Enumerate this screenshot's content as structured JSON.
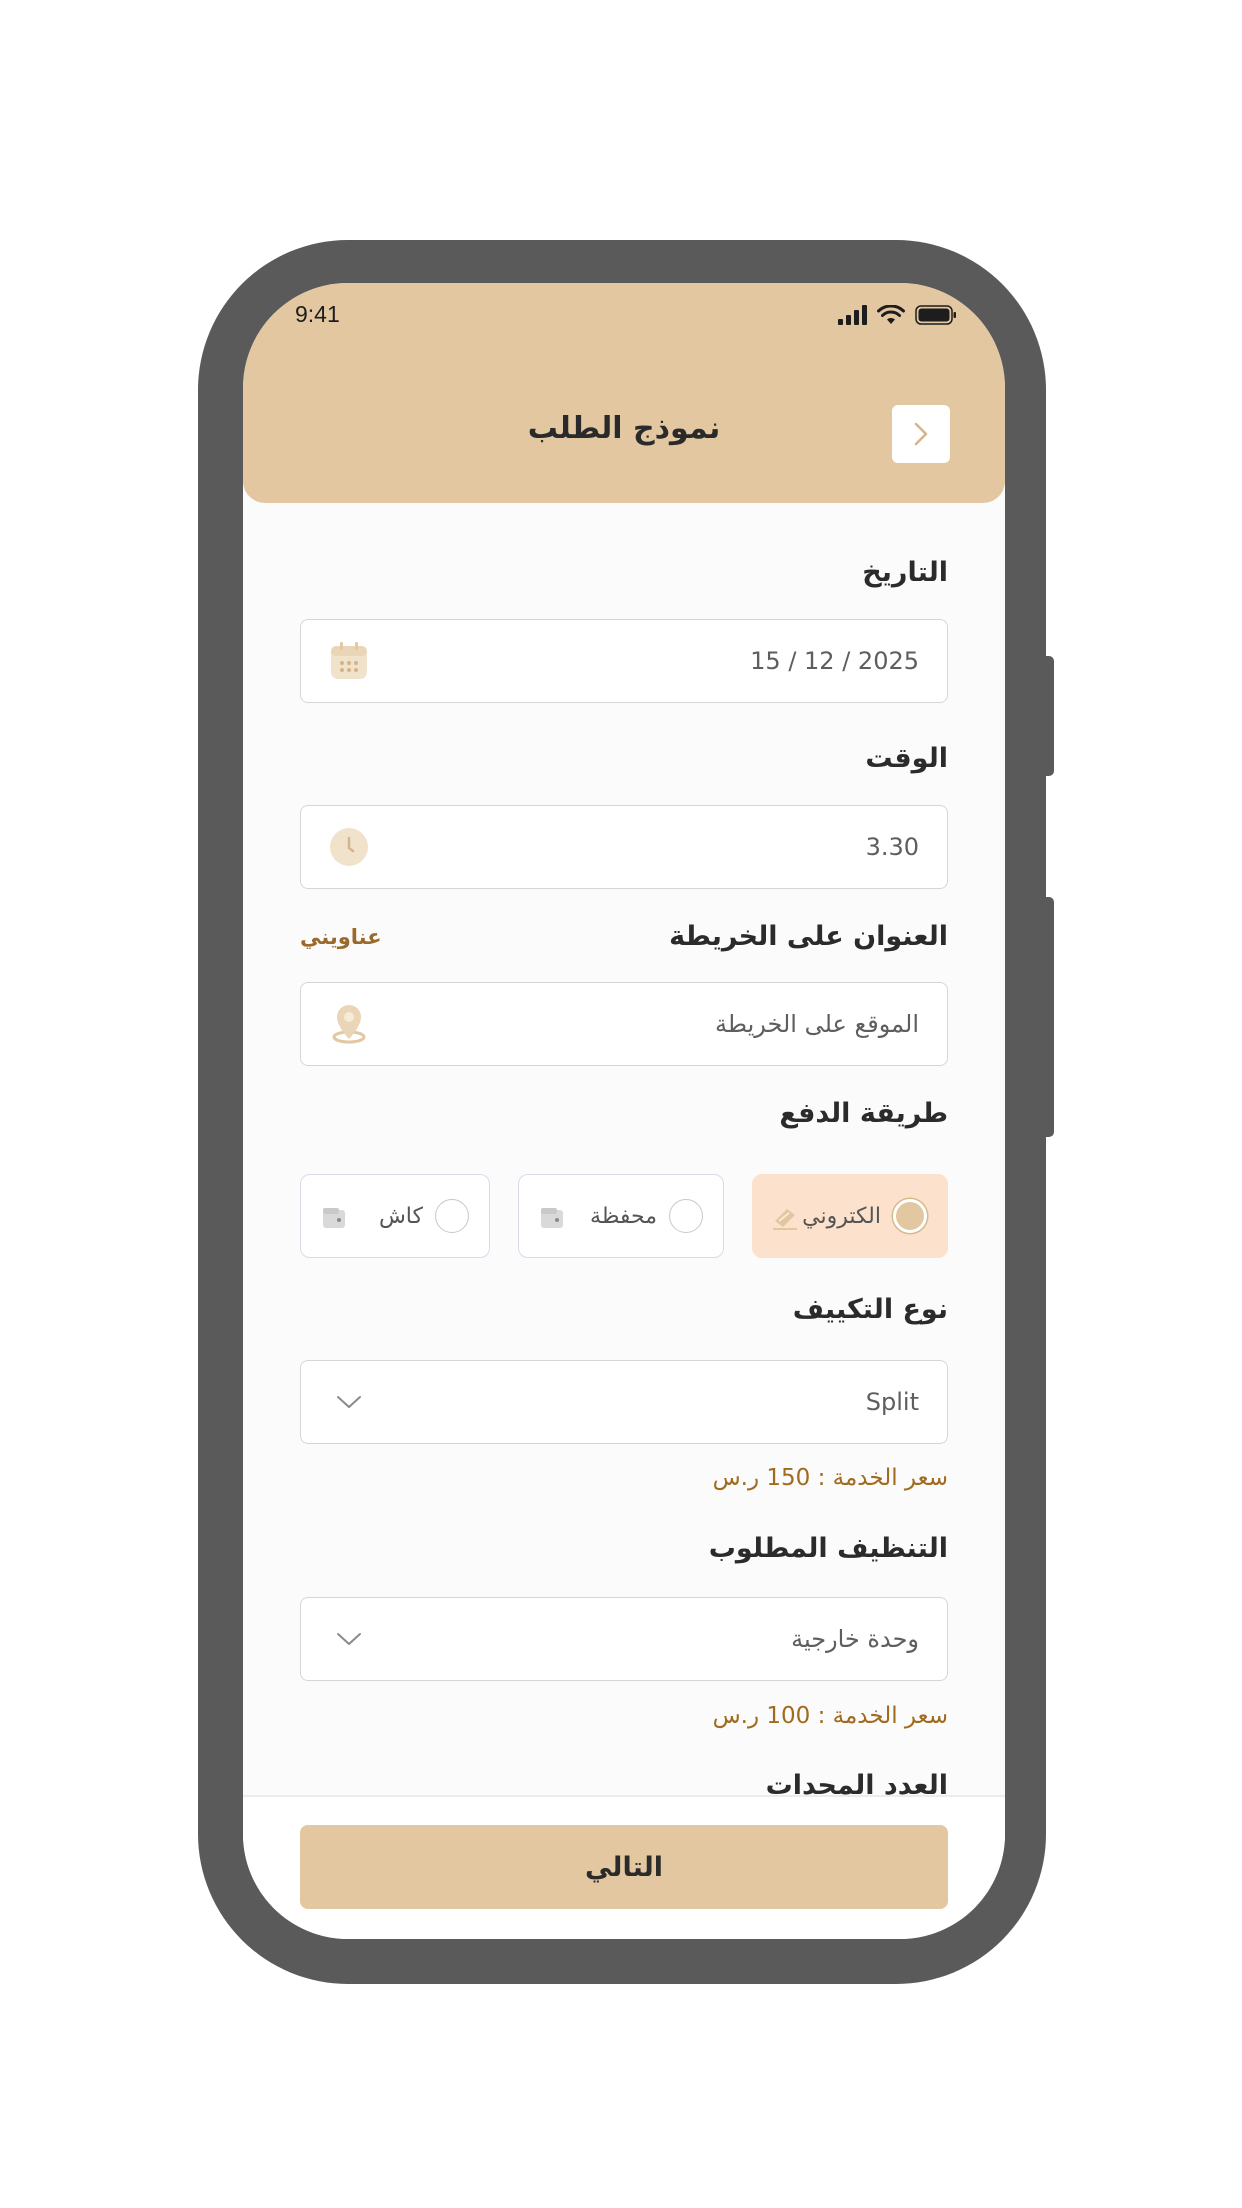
{
  "status_bar": {
    "time": "9:41"
  },
  "header": {
    "title": "نموذج الطلب"
  },
  "form": {
    "date": {
      "label": "التاريخ",
      "value": "2025 / 12 / 15"
    },
    "time": {
      "label": "الوقت",
      "value": "3.30"
    },
    "address": {
      "label": "العنوان على الخريطة",
      "link": "عناويني",
      "placeholder": "الموقع على الخريطة"
    },
    "payment": {
      "label": "طريقة الدفع",
      "options": [
        {
          "label": "الكتروني",
          "selected": true
        },
        {
          "label": "محفظة",
          "selected": false
        },
        {
          "label": "كاش",
          "selected": false
        }
      ]
    },
    "ac_type": {
      "label": "نوع التكييف",
      "value": "Split",
      "price": "سعر الخدمة : 150 ر.س"
    },
    "cleaning": {
      "label": "التنظيف المطلوب",
      "value": "وحدة خارجية",
      "price": "سعر الخدمة : 100 ر.س"
    },
    "units_label": "العدد المحدات"
  },
  "footer": {
    "next_label": "التالي"
  },
  "colors": {
    "primary": "#e3c7a0",
    "accent_text": "#a06b1f",
    "selected_bg": "#fce1cd"
  }
}
